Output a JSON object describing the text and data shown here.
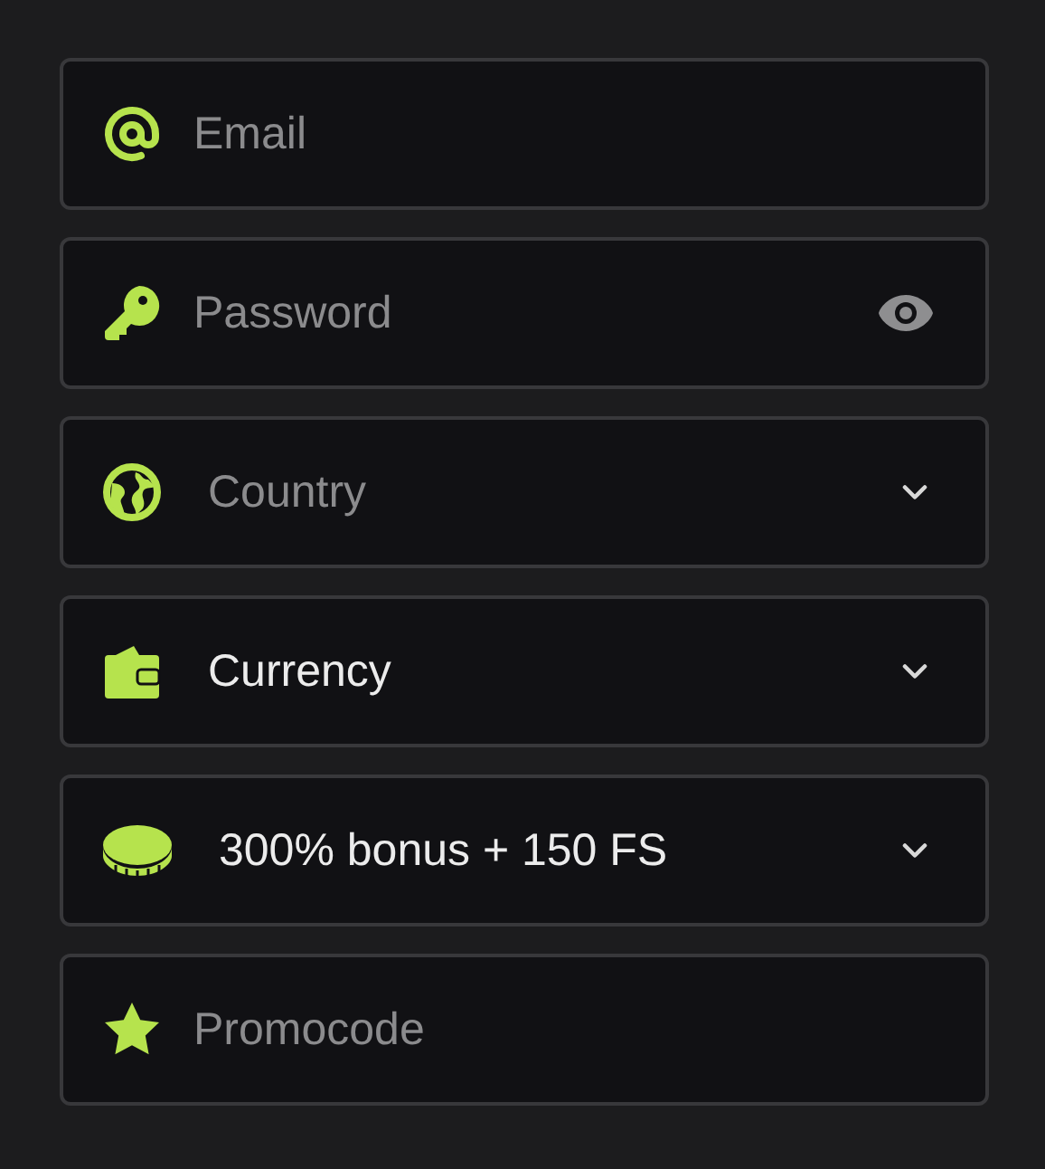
{
  "fields": [
    {
      "kind": "input",
      "placeholder": "Email"
    },
    {
      "kind": "password",
      "placeholder": "Password"
    },
    {
      "kind": "select",
      "placeholder": "Country"
    },
    {
      "kind": "select",
      "value": "Currency"
    },
    {
      "kind": "select",
      "value": "300% bonus + 150 FS"
    },
    {
      "kind": "input",
      "placeholder": "Promocode"
    }
  ]
}
